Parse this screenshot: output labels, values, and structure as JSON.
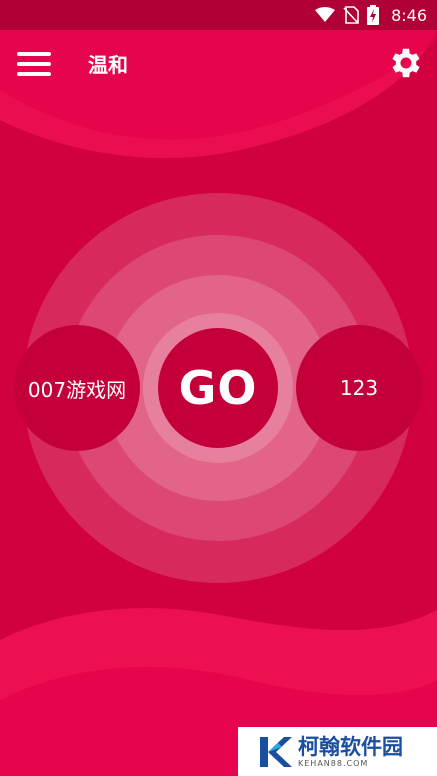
{
  "status_bar": {
    "time": "8:46",
    "icons": [
      "wifi-icon",
      "no-sim-icon",
      "battery-charging-icon"
    ]
  },
  "app_bar": {
    "title": "温和",
    "menu_icon": "hamburger-menu-icon",
    "settings_icon": "gear-icon"
  },
  "main": {
    "go_label": "GO",
    "left_label": "007游戏网",
    "right_label": "123"
  },
  "watermark": {
    "title": "柯翰软件园",
    "subtitle": "KEHAN88.COM",
    "logo": "k-logo-icon"
  },
  "colors": {
    "primary": "#d1003f",
    "status_bar": "#b10035",
    "circle": "#c4003a",
    "wave_light": "#ff1a5e",
    "watermark_brand": "#1a4fa0"
  }
}
